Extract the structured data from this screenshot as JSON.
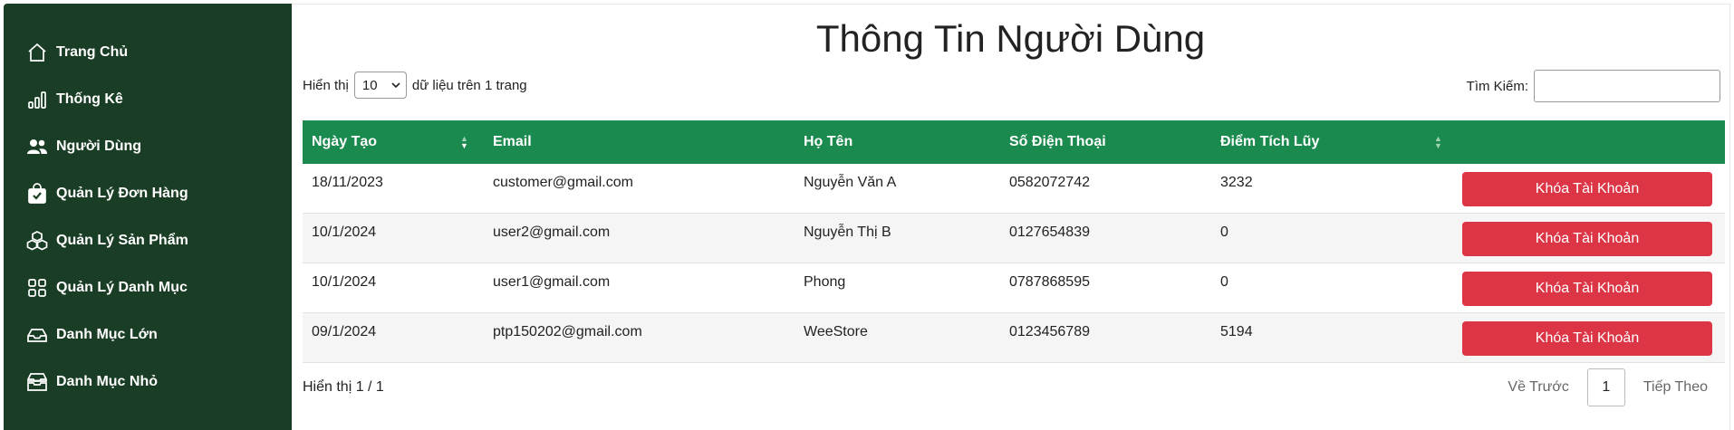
{
  "sidebar": {
    "items": [
      {
        "label": "Trang Chủ",
        "icon": "home-icon"
      },
      {
        "label": "Thống Kê",
        "icon": "chart-bars-icon"
      },
      {
        "label": "Người Dùng",
        "icon": "users-icon"
      },
      {
        "label": "Quản Lý Đơn Hàng",
        "icon": "bag-check-icon"
      },
      {
        "label": "Quản Lý Sản Phẩm",
        "icon": "boxes-icon"
      },
      {
        "label": "Quản Lý Danh Mục",
        "icon": "grid-icon"
      },
      {
        "label": "Danh Mục Lớn",
        "icon": "inbox-icon"
      },
      {
        "label": "Danh Mục Nhỏ",
        "icon": "inboxes-icon"
      }
    ]
  },
  "page": {
    "title": "Thông Tin Người Dùng",
    "length_prefix": "Hiển thị",
    "length_value": "10",
    "length_suffix": "dữ liệu trên 1 trang",
    "search_label": "Tìm Kiếm:",
    "search_value": ""
  },
  "table": {
    "headers": [
      "Ngày Tạo",
      "Email",
      "Họ Tên",
      "Số Điện Thoại",
      "Điểm Tích Lũy",
      ""
    ],
    "rows": [
      {
        "date": "18/11/2023",
        "email": "customer@gmail.com",
        "name": "Nguyễn Văn A",
        "phone": "0582072742",
        "points": "3232",
        "action": "Khóa Tài Khoản"
      },
      {
        "date": "10/1/2024",
        "email": "user2@gmail.com",
        "name": "Nguyễn Thị B",
        "phone": "0127654839",
        "points": "0",
        "action": "Khóa Tài Khoản"
      },
      {
        "date": "10/1/2024",
        "email": "user1@gmail.com",
        "name": "Phong",
        "phone": "0787868595",
        "points": "0",
        "action": "Khóa Tài Khoản"
      },
      {
        "date": "09/1/2024",
        "email": "ptp150202@gmail.com",
        "name": "WeeStore",
        "phone": "0123456789",
        "points": "5194",
        "action": "Khóa Tài Khoản"
      }
    ]
  },
  "footer": {
    "info": "Hiển thị 1 / 1",
    "prev": "Về Trước",
    "page": "1",
    "next": "Tiếp Theo"
  },
  "colors": {
    "sidebar_bg": "#1a3d25",
    "header_bg": "#1b8a4f",
    "danger": "#dc3545"
  }
}
